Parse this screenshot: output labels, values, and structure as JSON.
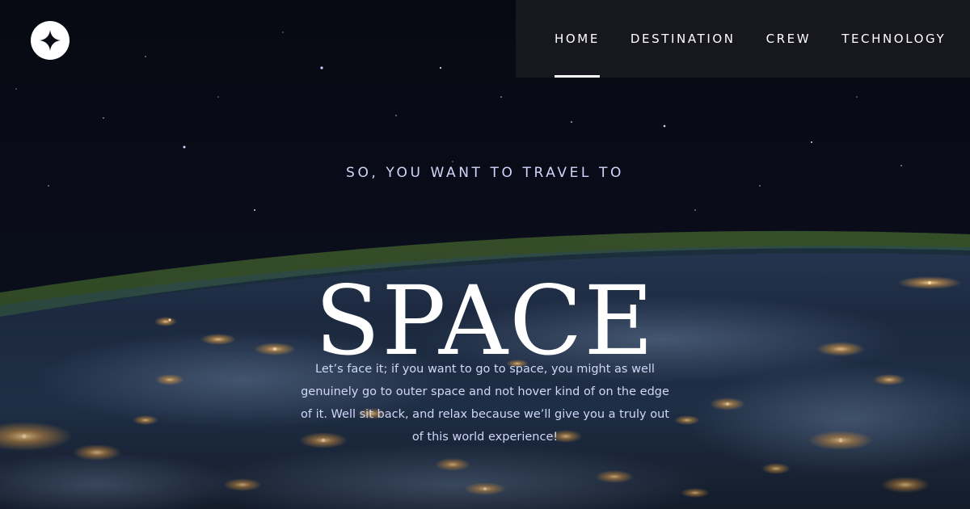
{
  "brand": {
    "logo_icon": "four-point-star-icon",
    "logo_color": "#ffffff"
  },
  "nav": {
    "items": [
      {
        "label": "HOME",
        "active": true
      },
      {
        "label": "DESTINATION",
        "active": false
      },
      {
        "label": "CREW",
        "active": false
      },
      {
        "label": "TECHNOLOGY",
        "active": false
      }
    ]
  },
  "hero": {
    "eyebrow": "SO, YOU WANT TO TRAVEL TO",
    "title": "SPACE",
    "body": "Let’s face it; if you want to go to space, you might as well genuinely go to outer space and not hover kind of on the edge of it. Well sit back, and relax because we’ll give you a truly out of this world experience!"
  },
  "colors": {
    "background": "#0b0d17",
    "nav_background": "#18181f",
    "accent_text": "#d0d6f9",
    "white": "#ffffff"
  }
}
